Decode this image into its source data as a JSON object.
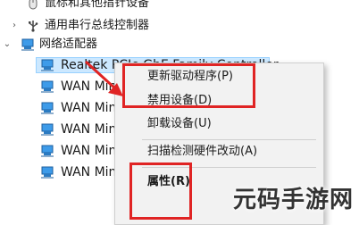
{
  "tree": {
    "mouse_devices": "鼠标和其他指针设备",
    "usb_controllers": "通用串行总线控制器",
    "network_adapters": "网络适配器",
    "selected_adapter": "Realtek PCIe GbE Family Controller",
    "wan_items": [
      "WAN Miniport (IKEv2)",
      "WAN Miniport (IP)",
      "WAN Miniport (IPv6)",
      "WAN Miniport (L2TP)",
      "WAN Miniport (Network Monitor)"
    ]
  },
  "context_menu": {
    "update_driver": "更新驱动程序(P)",
    "disable_device": "禁用设备(D)",
    "uninstall_device": "卸载设备(U)",
    "scan_hardware": "扫描检测硬件改动(A)",
    "properties": "属性(R)"
  },
  "watermark": "元码手游网",
  "colors": {
    "highlight": "#cce8ff",
    "annotation_red": "#e02424"
  }
}
